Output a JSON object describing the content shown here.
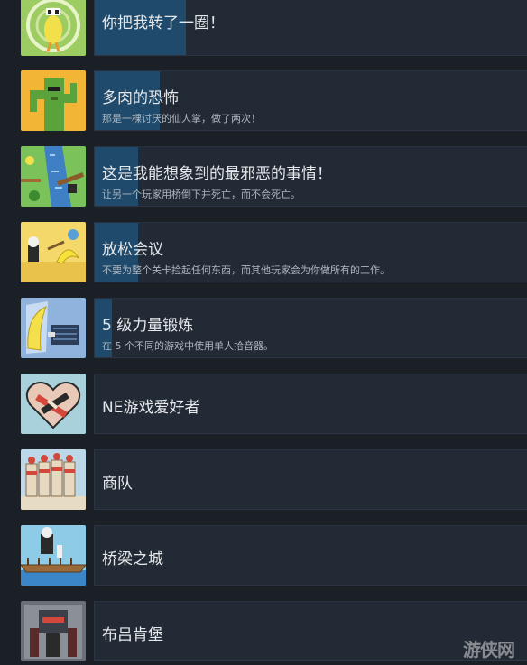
{
  "achievements": [
    {
      "title": "你把我转了一圈！",
      "desc": "",
      "progress_fraction": 0.21,
      "icon": "spinning-duck-icon"
    },
    {
      "title": "多肉的恐怖",
      "desc": "那是一棵讨厌的仙人掌，做了两次！",
      "progress_fraction": 0.15,
      "icon": "cactus-icon"
    },
    {
      "title": "这是我能想象到的最邪恶的事情！",
      "desc": "让另一个玩家用桥倒下并死亡，而不会死亡。",
      "progress_fraction": 0.1,
      "icon": "bridge-fall-icon"
    },
    {
      "title": "放松会议",
      "desc": "不要为整个关卡捡起任何东西，而其他玩家会为你做所有的工作。",
      "progress_fraction": 0.1,
      "icon": "relaxing-banana-icon"
    },
    {
      "title": "5 级力量锻炼",
      "desc": "在 5 个不同的游戏中使用单人拾音器。",
      "progress_fraction": 0.04,
      "icon": "banana-lifting-icon"
    },
    {
      "title": "NE游戏爱好者",
      "desc": "",
      "progress_fraction": 0,
      "icon": "heart-handshake-icon"
    },
    {
      "title": "商队",
      "desc": "",
      "progress_fraction": 0,
      "icon": "caravan-icon"
    },
    {
      "title": "桥梁之城",
      "desc": "",
      "progress_fraction": 0,
      "icon": "bridge-city-icon"
    },
    {
      "title": "布吕肯堡",
      "desc": "",
      "progress_fraction": 0,
      "icon": "castle-knight-icon"
    }
  ],
  "watermark": "游侠网"
}
